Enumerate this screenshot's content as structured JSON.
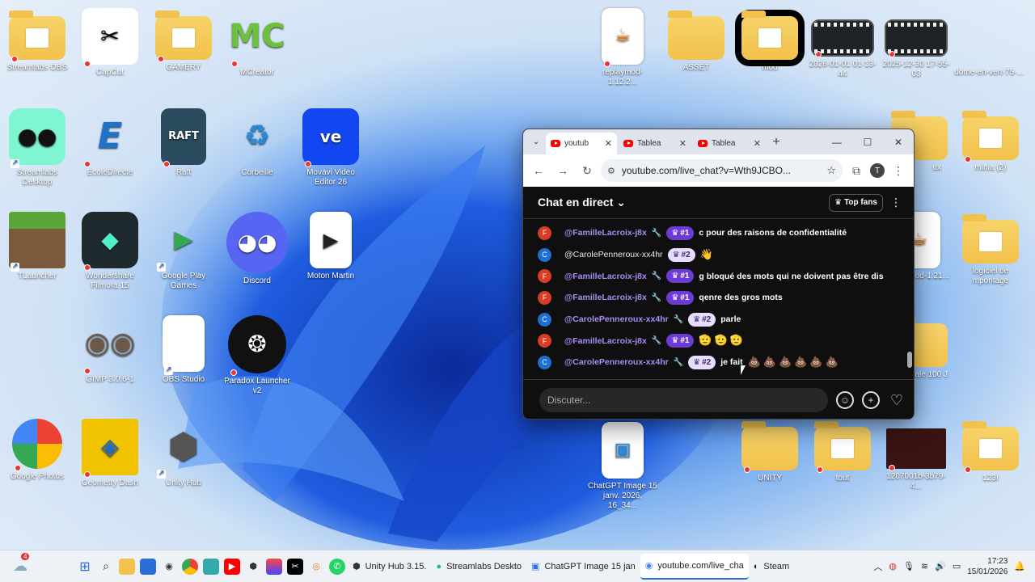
{
  "desktop": {
    "left_icons": [
      {
        "label": "Streamlabs OBS",
        "kind": "folder"
      },
      {
        "label": "CapCut",
        "kind": "app"
      },
      {
        "label": "GAMERY",
        "kind": "folder"
      },
      {
        "label": "MCreator",
        "kind": "app"
      },
      {
        "label": "Streamlabs Desktop",
        "kind": "app"
      },
      {
        "label": "EcoleDirecte",
        "kind": "app"
      },
      {
        "label": "Raft",
        "kind": "app"
      },
      {
        "label": "Corbeille",
        "kind": "app"
      },
      {
        "label": "Movavi Video Editor 26",
        "kind": "app"
      },
      {
        "label": "TLauncher",
        "kind": "app"
      },
      {
        "label": "Wondershare Filmora 15",
        "kind": "app"
      },
      {
        "label": "Google Play Games",
        "kind": "app"
      },
      {
        "label": "Discord",
        "kind": "app"
      },
      {
        "label": "Moton Martin",
        "kind": "app"
      },
      {
        "label": "GIMP 3.0.6-1",
        "kind": "app"
      },
      {
        "label": "OBS Studio",
        "kind": "file"
      },
      {
        "label": "Paradox Launcher v2",
        "kind": "app"
      },
      {
        "label": "Google Photos",
        "kind": "app"
      },
      {
        "label": "Geometry Dash",
        "kind": "app"
      },
      {
        "label": "Unity Hub",
        "kind": "app"
      }
    ],
    "top_right_icons": [
      {
        "label": "replaymod-1.12.2..."
      },
      {
        "label": "ASSET"
      },
      {
        "label": "mod"
      },
      {
        "label": "2026-01-01 01-13-44"
      },
      {
        "label": "2025-12-30 17-55-03"
      },
      {
        "label": "dome-en-vert-75-..."
      }
    ],
    "right_icons": [
      {
        "label": "ux"
      },
      {
        "label": "minia (2)"
      },
      {
        "label": "nod-1.21..."
      },
      {
        "label": "logiciel de mpontage"
      },
      {
        "label": "iale 100 J"
      }
    ],
    "bottom_icons": [
      {
        "label": "ChatGPT Image 15 janv. 2026, 16_34..."
      },
      {
        "label": "UNITY"
      },
      {
        "label": "tout"
      },
      {
        "label": "1207001b-3b79-4..."
      },
      {
        "label": "123I"
      }
    ]
  },
  "browser": {
    "tabs": [
      {
        "label": "youtub",
        "active": true
      },
      {
        "label": "Tablea",
        "active": false
      },
      {
        "label": "Tablea",
        "active": false
      }
    ],
    "new_tab": "+",
    "url": "youtube.com/live_chat?v=Wth9JCBO...",
    "profile_initial": "T"
  },
  "chat": {
    "title": "Chat en direct",
    "top_fans_label": "Top fans",
    "messages": [
      {
        "initial": "F",
        "color": "#d93c24",
        "author": "@FamilleLacroix-j8x",
        "mod": true,
        "badge": "#1",
        "text": "c pour des raisons de confidentialité",
        "emoji": ""
      },
      {
        "initial": "C",
        "color": "#1e6fd0",
        "author": "@CarolePenneroux-xx4hr",
        "mod": false,
        "badge": "#2",
        "text": "",
        "emoji": "👋"
      },
      {
        "initial": "F",
        "color": "#d93c24",
        "author": "@FamilleLacroix-j8x",
        "mod": true,
        "badge": "#1",
        "text": "g bloqué des mots qui ne doivent pas être dis",
        "emoji": ""
      },
      {
        "initial": "F",
        "color": "#d93c24",
        "author": "@FamilleLacroix-j8x",
        "mod": true,
        "badge": "#1",
        "text": "qenre des gros mots",
        "emoji": ""
      },
      {
        "initial": "C",
        "color": "#1e6fd0",
        "author": "@CarolePenneroux-xx4hr",
        "mod": true,
        "badge": "#2",
        "text": "parle",
        "emoji": ""
      },
      {
        "initial": "F",
        "color": "#d93c24",
        "author": "@FamilleLacroix-j8x",
        "mod": true,
        "badge": "#1",
        "text": "",
        "emoji": "🫡🫡🫡"
      },
      {
        "initial": "C",
        "color": "#1e6fd0",
        "author": "@CarolePenneroux-xx4hr",
        "mod": true,
        "badge": "#2",
        "text": "je fait",
        "emoji": "💩💩💩💩💩💩"
      }
    ],
    "composer_placeholder": "Discuter..."
  },
  "taskbar": {
    "weather_badge": "4",
    "apps": [
      {
        "label": "Unity Hub 3.15.",
        "color": "#333"
      },
      {
        "label": "Streamlabs Deskto",
        "color": "#1dbd8a"
      },
      {
        "label": "ChatGPT Image 15 jan",
        "color": "#2a6fd8"
      },
      {
        "label": "youtube.com/live_cha",
        "color": "#e44"
      },
      {
        "label": "Steam",
        "color": "#1b2838"
      }
    ],
    "time": "17:23",
    "date": "15/01/2026"
  }
}
